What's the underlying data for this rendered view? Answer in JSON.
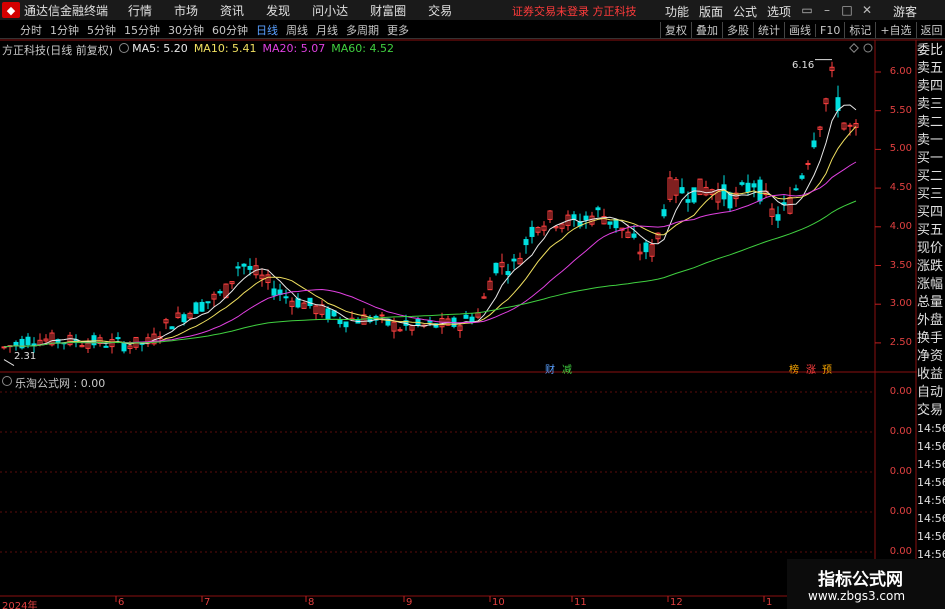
{
  "app": {
    "title": "通达信金融终端",
    "broker": "证券交易未登录  方正科技",
    "guest": "游客"
  },
  "menu": [
    "行情",
    "市场",
    "资讯",
    "发现",
    "问小达",
    "财富圈",
    "交易"
  ],
  "right_menu": [
    "功能",
    "版面",
    "公式",
    "选项"
  ],
  "periods": [
    "分时",
    "1分钟",
    "5分钟",
    "15分钟",
    "30分钟",
    "60分钟",
    "日线",
    "周线",
    "月线",
    "多周期",
    "更多"
  ],
  "active_period": "日线",
  "tool_buttons": [
    "复权",
    "叠加",
    "多股",
    "统计",
    "画线",
    "F10",
    "标记",
    "+自选",
    "返回"
  ],
  "chart_header": {
    "name": "方正科技(日线 前复权)",
    "ma5": "MA5: 5.20",
    "ma10": "MA10: 5.41",
    "ma20": "MA20: 5.07",
    "ma60": "MA60: 4.52"
  },
  "sub_header": {
    "name": "乐淘公式网 : 0.00"
  },
  "right_panel": [
    "委比",
    "卖五",
    "卖四",
    "卖三",
    "卖二",
    "卖一",
    "买一",
    "买二",
    "买三",
    "买四",
    "买五",
    "现价",
    "涨跌",
    "涨幅",
    "总量",
    "外盘",
    "换手",
    "净资",
    "收益",
    "自动",
    "交易",
    "14:56",
    "14:56",
    "14:56",
    "14:56",
    "14:56",
    "14:56",
    "14:56",
    "14:56"
  ],
  "y_axis": [
    "6.00",
    "5.50",
    "5.00",
    "4.50",
    "4.00",
    "3.50",
    "3.00",
    "2.50"
  ],
  "sub_y_axis": [
    "0.00",
    "0.00",
    "0.00",
    "0.00",
    "0.00"
  ],
  "x_axis": [
    "2024年",
    "6",
    "7",
    "8",
    "9",
    "10",
    "11",
    "12",
    "1"
  ],
  "annotations": {
    "high": "6.16",
    "low": "2.31",
    "tag1": "财",
    "tag2": "减",
    "tag3": "榜",
    "tag4": "涨",
    "tag5": "预"
  },
  "watermark": {
    "cn": "指标公式网",
    "url": "www.zbgs3.com"
  },
  "colors": {
    "up": "#ff4040",
    "down": "#00e0e0",
    "ma5": "#e8e8e8",
    "ma10": "#f0e060",
    "ma20": "#e040e0",
    "ma60": "#40d040",
    "axis": "#e04040"
  },
  "chart_data": {
    "type": "candlestick",
    "x_ticks": [
      "2024年",
      "6",
      "7",
      "8",
      "9",
      "10",
      "11",
      "12",
      "1"
    ],
    "ylim": [
      2.2,
      6.3
    ],
    "high": 6.16,
    "low": 2.31,
    "ma5_last": 5.2,
    "ma10_last": 5.41,
    "ma20_last": 5.07,
    "ma60_last": 4.52
  }
}
